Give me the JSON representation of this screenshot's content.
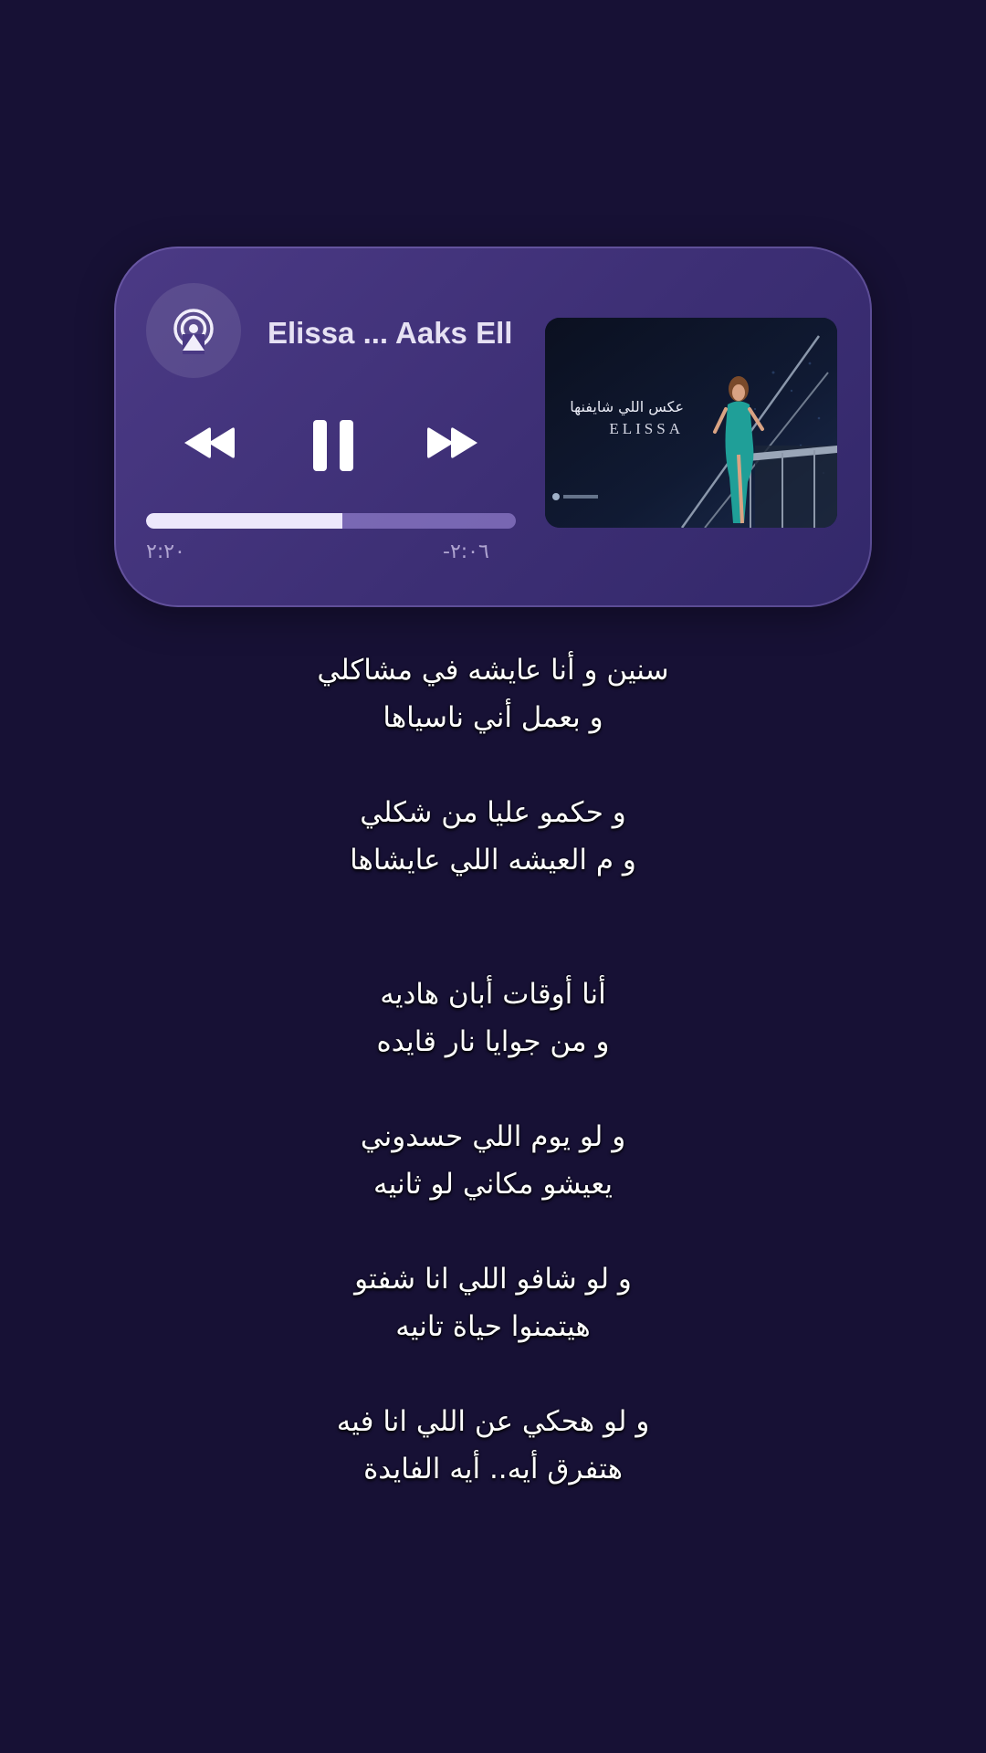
{
  "player": {
    "track_title": "Elissa ... Aaks Ell",
    "elapsed_time": "٢:٢٠",
    "remaining_time": "-٢:٠٦",
    "progress_fraction": 0.53,
    "controls": {
      "rewind_icon": "rewind-icon",
      "pause_icon": "pause-icon",
      "forward_icon": "fast-forward-icon",
      "output_icon": "airplay-icon"
    },
    "artwork": {
      "title": "عكس اللي شايفنها",
      "artist": "ELISSA"
    }
  },
  "lyrics": [
    [
      "سنين و أنا عايشه في مشاكلي",
      "و بعمل أني ناسياها"
    ],
    [
      "و حكمو عليا من شكلي",
      "و م العيشه اللي عايشاها"
    ],
    [
      "أنا أوقات أبان هاديه",
      "و من جوايا نار قايده"
    ],
    [
      "و لو يوم اللي حسدوني",
      "يعيشو مكاني لو ثانيه"
    ],
    [
      "و لو شافو اللي انا شفتو",
      "هيتمنوا حياة تانيه"
    ],
    [
      "و لو هحكي عن اللي انا فيه",
      "هتفرق أيه.. أيه الفايدة"
    ]
  ],
  "colors": {
    "background": "#171135",
    "card": "#42337c",
    "progress_fill": "#ece7fb"
  }
}
